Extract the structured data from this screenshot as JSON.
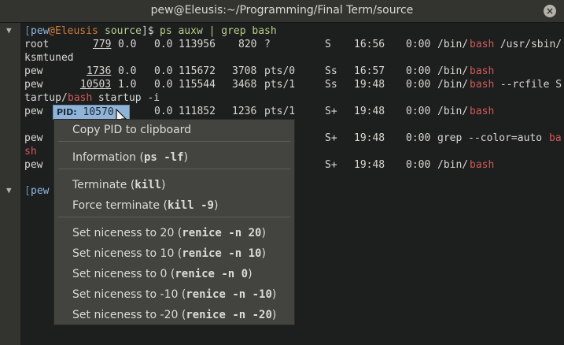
{
  "window": {
    "title": "pew@Eleusis:~/Programming/Final Term/source",
    "close_glyph": "×"
  },
  "gutter": {
    "fold_glyph": "▼"
  },
  "prompt": {
    "open": "[",
    "user": "pew",
    "at": "@",
    "host": "Eleusis",
    "space": " ",
    "dir": "source",
    "close": "]$",
    "command": "ps auxw | grep bash"
  },
  "rows": [
    {
      "user": "root",
      "pid": "779",
      "cpu": "0.0",
      "mem": "0.0",
      "vsz": "113956",
      "rss": "820",
      "tty": "?",
      "stat": "S",
      "start": "16:56",
      "time": "0:00",
      "cmd_pre": "/bin/",
      "cmd_hl": "bash",
      "cmd_post": " /usr/sbin/",
      "wrap": "ksmtuned"
    },
    {
      "user": "pew",
      "pid": "1736",
      "cpu": "0.0",
      "mem": "0.0",
      "vsz": "115672",
      "rss": "3708",
      "tty": "pts/0",
      "stat": "Ss",
      "start": "16:57",
      "time": "0:00",
      "cmd_pre": "/bin/",
      "cmd_hl": "bash",
      "cmd_post": ""
    },
    {
      "user": "pew",
      "pid": "10503",
      "cpu": "1.0",
      "mem": "0.0",
      "vsz": "115544",
      "rss": "3468",
      "tty": "pts/1",
      "stat": "Ss",
      "start": "19:48",
      "time": "0:00",
      "cmd_pre": "/bin/",
      "cmd_hl": "bash",
      "cmd_post": " --rcfile S",
      "wrap_pre": "tartup/",
      "wrap_hl": "bash",
      "wrap_post": " startup -i"
    },
    {
      "user": "pew",
      "pid": "10570",
      "cpu": "0.0",
      "mem": "0.0",
      "vsz": "111852",
      "rss": "1236",
      "tty": "pts/1",
      "stat": "S+",
      "start": "19:48",
      "time": "0:00",
      "cmd_pre": "/bin/",
      "cmd_hl": "bash",
      "cmd_post": ""
    },
    {
      "user": "pew",
      "stat": "S+",
      "start": "19:48",
      "time": "0:00",
      "cmd_pre": "grep --color=auto ",
      "cmd_hl": "ba",
      "wrap_hl": "sh"
    },
    {
      "user": "pew",
      "stat": "S+",
      "start": "19:48",
      "time": "0:00",
      "cmd_pre": "/bin/",
      "cmd_hl": "bash"
    }
  ],
  "pid_tooltip": {
    "key": "PID:",
    "value": "10570"
  },
  "context_menu": {
    "items": [
      {
        "label": "Copy PID to clipboard",
        "code": ""
      },
      {
        "label": "Information (",
        "code": "ps -lf",
        "suffix": ")"
      },
      {
        "label": "Terminate (",
        "code": "kill",
        "suffix": ")"
      },
      {
        "label": "Force terminate (",
        "code": "kill -9",
        "suffix": ")"
      },
      {
        "label": "Set niceness to 20 (",
        "code": "renice -n 20",
        "suffix": ")"
      },
      {
        "label": "Set niceness to 10 (",
        "code": "renice -n 10",
        "suffix": ")"
      },
      {
        "label": "Set niceness to 0 (",
        "code": "renice -n 0",
        "suffix": ")"
      },
      {
        "label": "Set niceness to -10 (",
        "code": "renice -n -10",
        "suffix": ")"
      },
      {
        "label": "Set niceness to -20 (",
        "code": "renice -n -20",
        "suffix": ")"
      }
    ]
  },
  "colors": {
    "background": "#1d1f1e",
    "highlight": "#d05a5a",
    "prompt_user": "#8db6e0",
    "prompt_host": "#d07a3a",
    "prompt_path": "#b7cf8a",
    "menu_bg": "#43443f"
  }
}
